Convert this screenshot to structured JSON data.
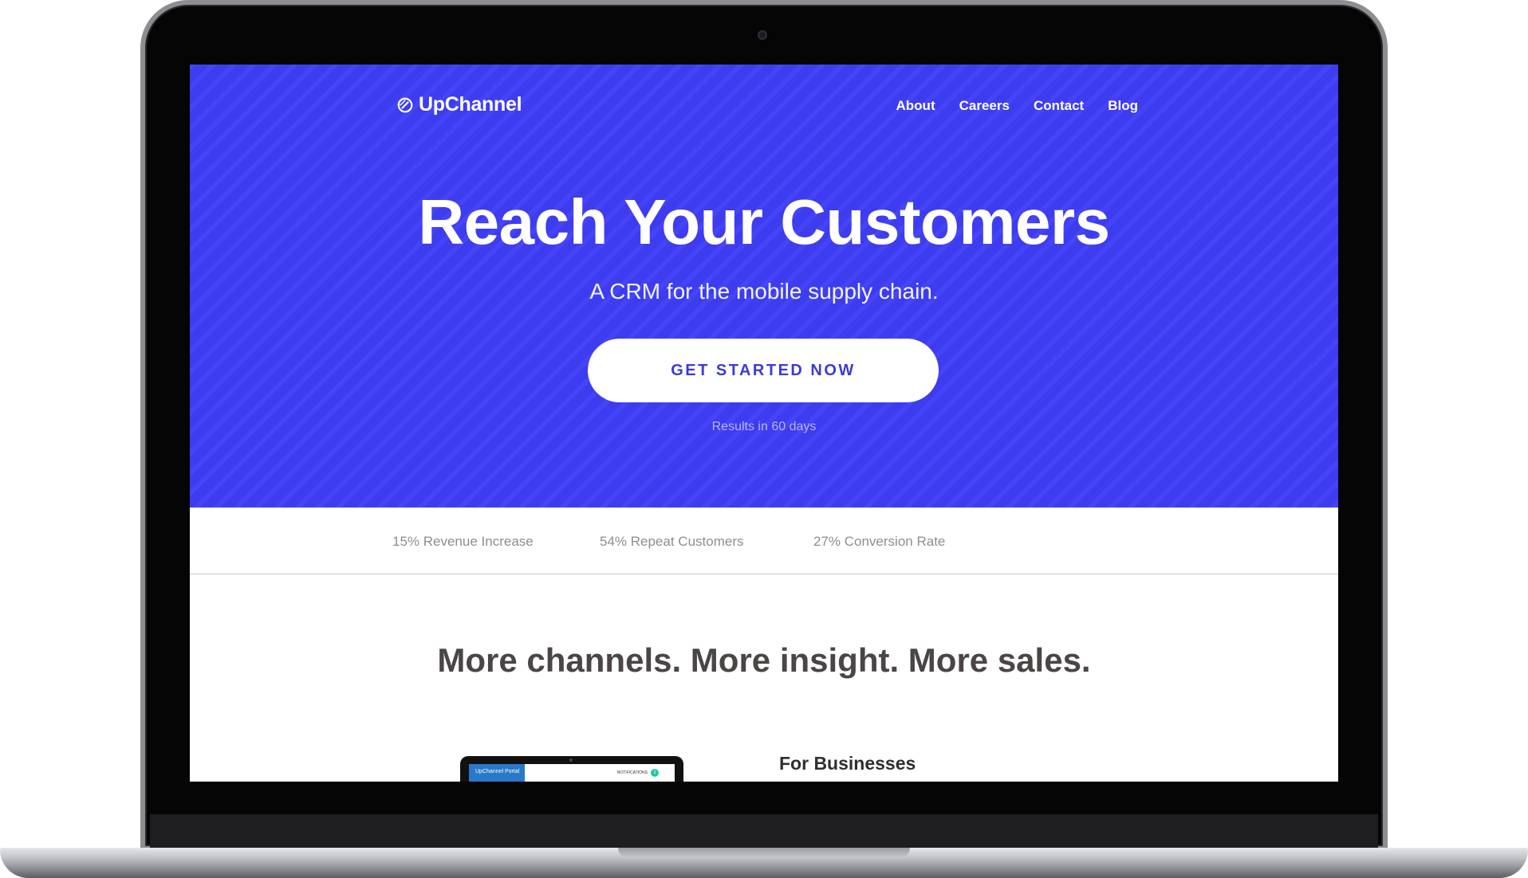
{
  "brand": {
    "name": "UpChannel",
    "icon": "slashed-circle-icon"
  },
  "nav": {
    "items": [
      {
        "label": "About"
      },
      {
        "label": "Careers"
      },
      {
        "label": "Contact"
      },
      {
        "label": "Blog"
      }
    ]
  },
  "hero": {
    "title": "Reach Your Customers",
    "subtitle": "A CRM for the mobile supply chain.",
    "cta_label": "GET STARTED NOW",
    "cta_note": "Results in 60 days"
  },
  "stats": [
    {
      "label": "15% Revenue Increase"
    },
    {
      "label": "54% Repeat Customers"
    },
    {
      "label": "27% Conversion Rate"
    }
  ],
  "features": {
    "title": "More channels. More insight. More sales.",
    "business_heading": "For Businesses",
    "preview": {
      "tab_label": "UpChannel Portal",
      "notifications_label": "NOTIFICATIONS",
      "notifications_count": "1"
    }
  },
  "colors": {
    "hero_bg": "#3f3ef8",
    "cta_text": "#3b3bd6",
    "heading_text": "#4b4545",
    "stat_text": "#8e8e8e",
    "notification_badge": "#1fc8a8",
    "portal_tab": "#2979c9"
  }
}
